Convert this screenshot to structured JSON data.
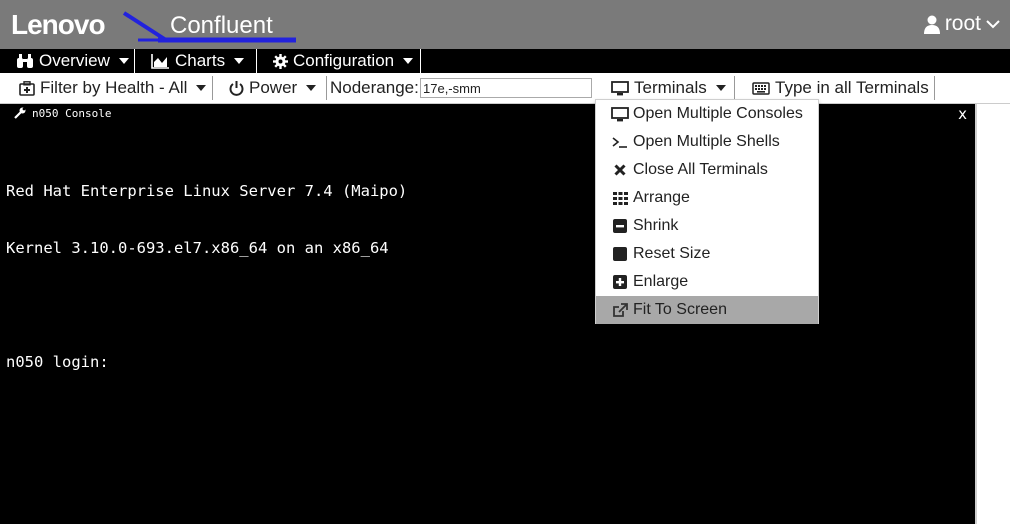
{
  "header": {
    "logo": "Lenovo",
    "app_title": "Confluent",
    "user": "root"
  },
  "nav": {
    "items": [
      {
        "label": "Overview"
      },
      {
        "label": "Charts"
      },
      {
        "label": "Configuration"
      }
    ]
  },
  "toolbar": {
    "filter_label": "Filter by Health - All",
    "power_label": "Power",
    "noderange_label": "Noderange:",
    "noderange_value": "17e,-smm",
    "terminals_label": "Terminals",
    "type_all_label": "Type in all Terminals"
  },
  "console": {
    "title": "n050 Console",
    "close": "x",
    "lines": [
      "Red Hat Enterprise Linux Server 7.4 (Maipo)",
      "Kernel 3.10.0-693.el7.x86_64 on an x86_64",
      "",
      "n050 login:"
    ]
  },
  "terminals_menu": {
    "items": [
      {
        "label": "Open Multiple Consoles",
        "icon": "monitor-icon"
      },
      {
        "label": "Open Multiple Shells",
        "icon": "terminal-icon"
      },
      {
        "label": "Close All Terminals",
        "icon": "close-x-icon"
      },
      {
        "label": "Arrange",
        "icon": "grid-icon"
      },
      {
        "label": "Shrink",
        "icon": "minus-square-icon"
      },
      {
        "label": "Reset Size",
        "icon": "square-icon"
      },
      {
        "label": "Enlarge",
        "icon": "plus-square-icon"
      },
      {
        "label": "Fit To Screen",
        "icon": "external-link-icon"
      }
    ],
    "active_index": 7
  },
  "colors": {
    "header_bg": "#7a7a7a",
    "nav_bg": "#000000",
    "logo_swoosh": "#2222dd",
    "menu_active_bg": "#a8a8a8"
  }
}
